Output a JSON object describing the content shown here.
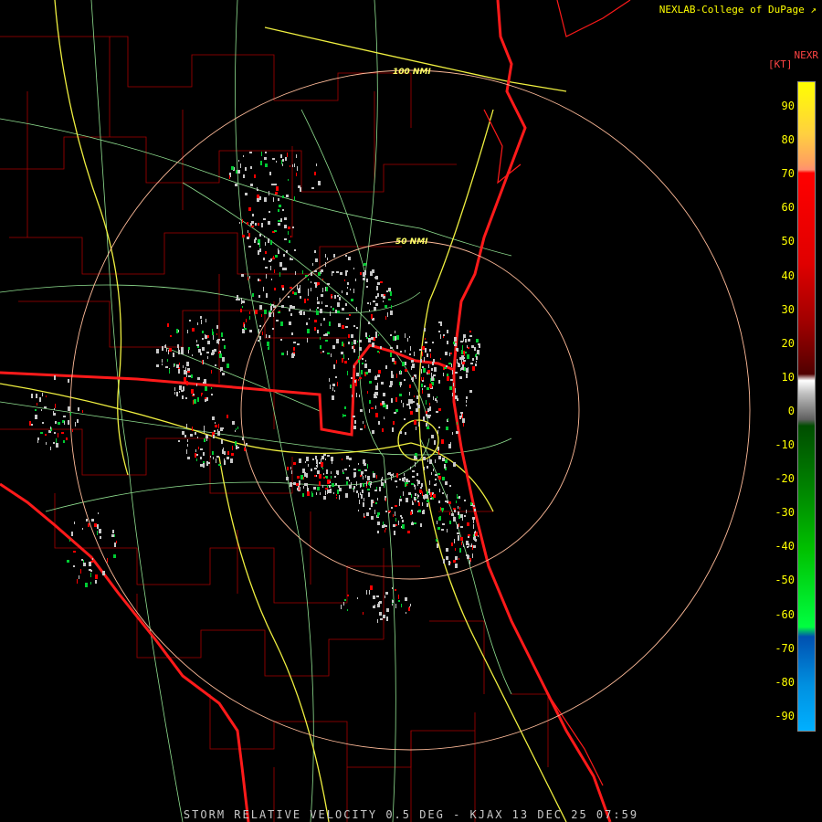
{
  "credit": "NEXLAB-College of DuPage",
  "product_line": "STORM RELATIVE VELOCITY 0.5 DEG - KJAX 13 DEC 25 07:59",
  "legend": {
    "title": "NEXR",
    "unit": "[KT]",
    "ticks": [
      "90",
      "80",
      "70",
      "60",
      "50",
      "40",
      "30",
      "20",
      "10",
      "0",
      "-10",
      "-20",
      "-30",
      "-40",
      "-50",
      "-60",
      "-70",
      "-80",
      "-90"
    ]
  },
  "range_rings": {
    "inner_label": "50 NMI",
    "outer_label": "100 NMI"
  },
  "colors": {
    "legend_text": "#ffff00",
    "coast_and_state_lines": "#ff0000",
    "county_lines": "#b00000",
    "highways": "#ffff40",
    "roads": "#90e090",
    "range_rings": "#ffbb99",
    "outbound": "#ff0000",
    "inbound": "#00cc33",
    "near_zero": "#c8c8c8"
  }
}
